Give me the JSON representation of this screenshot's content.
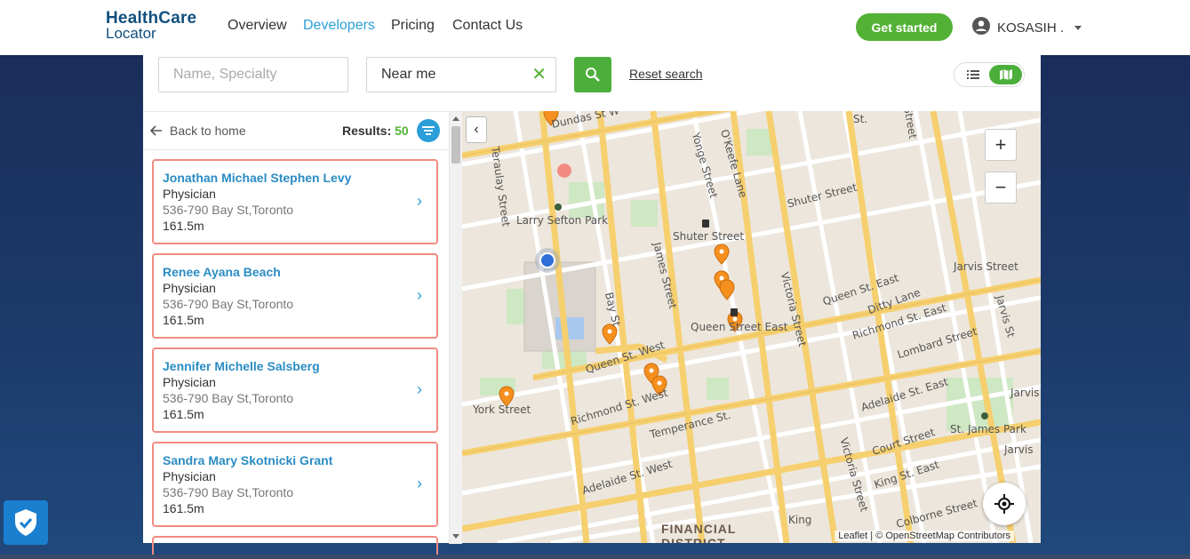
{
  "header": {
    "logo_line1": "HealthCare",
    "logo_line2": "Locator",
    "nav": [
      "Overview",
      "Developers",
      "Pricing",
      "Contact Us"
    ],
    "active_nav": "Developers",
    "cta_label": "Get started",
    "user_name": "KOSASIH ."
  },
  "search": {
    "name_placeholder": "Name, Specialty",
    "location_value": "Near me",
    "reset_label": "Reset search"
  },
  "list": {
    "back_label": "Back to home",
    "results_label": "Results:",
    "results_count": "50",
    "items": [
      {
        "name": "Jonathan Michael Stephen Levy",
        "type": "Physician",
        "address": "536-790 Bay St,Toronto",
        "distance": "161.5m"
      },
      {
        "name": "Renee Ayana Beach",
        "type": "Physician",
        "address": "536-790 Bay St,Toronto",
        "distance": "161.5m"
      },
      {
        "name": "Jennifer Michelle Salsberg",
        "type": "Physician",
        "address": "536-790 Bay St,Toronto",
        "distance": "161.5m"
      },
      {
        "name": "Sandra Mary Skotnicki Grant",
        "type": "Physician",
        "address": "536-790 Bay St,Toronto",
        "distance": "161.5m"
      }
    ]
  },
  "map": {
    "labels": {
      "dundas": "Dundas St W",
      "larry": "Larry Sefton Park",
      "shuter_st": "Shuter Street",
      "shuter_street2": "Shuter Street",
      "okeefe": "O'Keefe Lane",
      "yonge": "Yonge Street",
      "james": "James Street",
      "bay": "Bay St",
      "queen_w": "Queen St. West",
      "queen_e": "Queen Street East",
      "queen_e2": "Queen St. East",
      "victoria": "Victoria Street",
      "richmond_w": "Richmond St. West",
      "richmond_e": "Richmond St. East",
      "york": "York Street",
      "temperance": "Temperance St.",
      "adelaide_w": "Adelaide St. West",
      "adelaide_e": "Adelaide St. East",
      "jarvis": "Jarvis Street",
      "jarvis2": "Jarvis St",
      "jarvis3": "Jarvis",
      "ditty": "Ditty Lane",
      "lombard": "Lombard Street",
      "court": "Court Street",
      "king_e": "King St. East",
      "king": "King",
      "stjames": "St. James Park",
      "victoria2": "Victoria Street",
      "colborne": "Colborne Street",
      "teraulay": "Teraulay Street",
      "financial": "FINANCIAL",
      "district": "DISTRICT",
      "st": "St.",
      "street": "Street"
    },
    "attribution": "Leaflet | © OpenStreetMap Contributors"
  },
  "colors": {
    "brand": "#12507f",
    "accent_green": "#53b135",
    "link_blue": "#2b9ed9",
    "card_border": "#f28b82",
    "pin_orange": "#f5901f"
  }
}
